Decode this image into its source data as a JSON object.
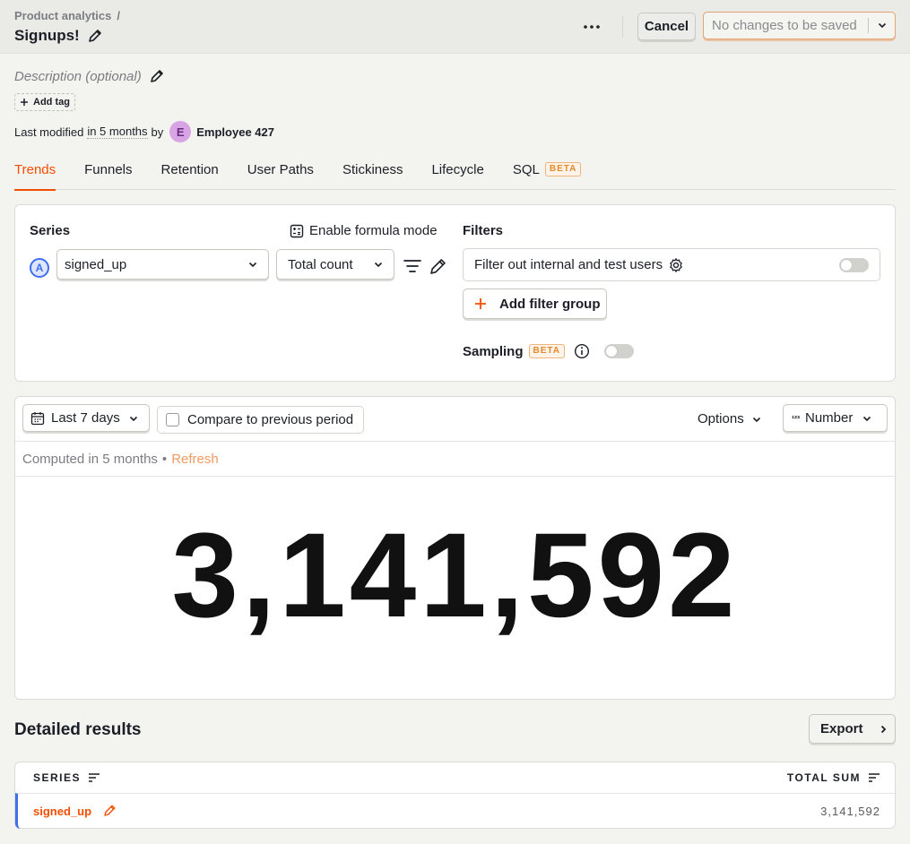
{
  "header": {
    "breadcrumb": "Product analytics",
    "breadcrumb_separator": "/",
    "title": "Signups!",
    "cancel_label": "Cancel",
    "save_label": "No changes to be saved"
  },
  "meta": {
    "description_placeholder": "Description (optional)",
    "add_tag_label": "Add tag",
    "modified_prefix": "Last modified",
    "modified_time": "in 5 months",
    "modified_by": "by",
    "user_initial": "E",
    "user_name": "Employee 427"
  },
  "tabs": [
    {
      "label": "Trends",
      "active": true
    },
    {
      "label": "Funnels"
    },
    {
      "label": "Retention"
    },
    {
      "label": "User Paths"
    },
    {
      "label": "Stickiness"
    },
    {
      "label": "Lifecycle"
    },
    {
      "label": "SQL",
      "badge": "BETA"
    }
  ],
  "query": {
    "series_label": "Series",
    "formula_label": "Enable formula mode",
    "series_letter": "A",
    "event": "signed_up",
    "math": "Total count",
    "filters_label": "Filters",
    "filter_internal_label": "Filter out internal and test users",
    "add_filter_group_label": "Add filter group",
    "sampling_label": "Sampling",
    "sampling_badge": "BETA"
  },
  "results": {
    "date_range": "Last 7 days",
    "compare_label": "Compare to previous period",
    "options_label": "Options",
    "display_label": "Number",
    "computed_text": "Computed in 5 months",
    "bullet": "•",
    "refresh_label": "Refresh",
    "big_number": "3,141,592"
  },
  "detailed": {
    "title": "Detailed results",
    "export_label": "Export",
    "columns": [
      "SERIES",
      "TOTAL SUM"
    ],
    "rows": [
      {
        "series": "signed_up",
        "total": "3,141,592"
      }
    ]
  },
  "colors": {
    "accent": "#f54e00",
    "series_a": "#3f6ef0"
  }
}
